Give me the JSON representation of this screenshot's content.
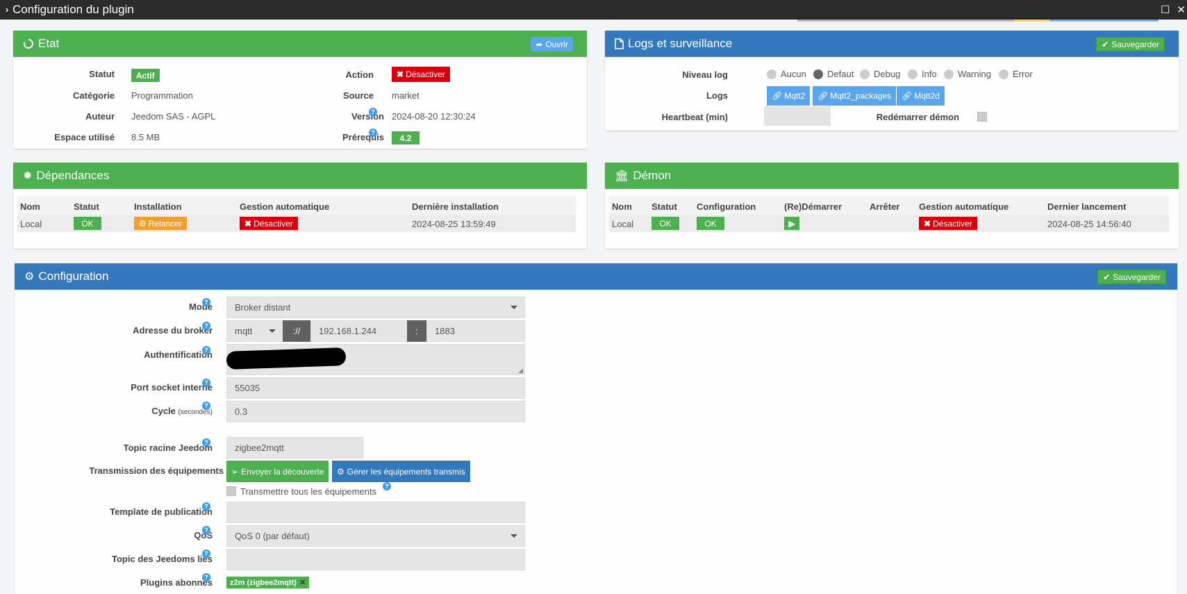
{
  "window": {
    "title": "Configuration du plugin"
  },
  "etat": {
    "title": "Etat",
    "open_btn": "Ouvrir",
    "statut_label": "Statut",
    "statut_value": "Actif",
    "categorie_label": "Catégorie",
    "categorie_value": "Programmation",
    "auteur_label": "Auteur",
    "auteur_value": "Jeedom SAS - AGPL",
    "espace_label": "Espace utilisé",
    "espace_value": "8.5 MB",
    "action_label": "Action",
    "action_btn": "Désactiver",
    "source_label": "Source",
    "source_value": "market",
    "version_label": "Version",
    "version_value": "2024-08-20 12:30:24",
    "prerequis_label": "Prérequis",
    "prerequis_value": "4.2"
  },
  "logs": {
    "title": "Logs et surveillance",
    "save_btn": "Sauvegarder",
    "niveau_label": "Niveau log",
    "levels": [
      "Aucun",
      "Defaut",
      "Debug",
      "Info",
      "Warning",
      "Error"
    ],
    "selected_level": "Defaut",
    "logs_label": "Logs",
    "log_buttons": [
      "Mqtt2",
      "Mqtt2_packages",
      "Mqtt2d"
    ],
    "heartbeat_label": "Heartbeat (min)",
    "heartbeat_value": "",
    "restart_label": "Redémarrer démon"
  },
  "deps": {
    "title": "Dépendances",
    "headers": [
      "Nom",
      "Statut",
      "Installation",
      "Gestion automatique",
      "Dernière installation"
    ],
    "row": {
      "nom": "Local",
      "statut": "OK",
      "installation": "Relancer",
      "gestion": "Désactiver",
      "derniere": "2024-08-25 13:59:49"
    }
  },
  "demon": {
    "title": "Démon",
    "headers": [
      "Nom",
      "Statut",
      "Configuration",
      "(Re)Démarrer",
      "Arrêter",
      "Gestion automatique",
      "Dernier lancement"
    ],
    "row": {
      "nom": "Local",
      "statut": "OK",
      "configuration": "OK",
      "gestion": "Désactiver",
      "dernier": "2024-08-25 14:56:40"
    }
  },
  "config": {
    "title": "Configuration",
    "save_btn": "Sauvegarder",
    "mode_label": "Mode",
    "mode_value": "Broker distant",
    "broker_label": "Adresse du broker",
    "broker_proto": "mqtt",
    "broker_sep": "://",
    "broker_host": "192.168.1.244",
    "broker_colon": ":",
    "broker_port": "1883",
    "auth_label": "Authentification",
    "port_label": "Port socket interne",
    "port_value": "55035",
    "cycle_label": "Cycle",
    "cycle_unit": "(secondes)",
    "cycle_value": "0.3",
    "topic_label": "Topic racine Jeedom",
    "topic_value": "zigbee2mqtt",
    "trans_label": "Transmission des équipements",
    "discover_btn": "Envoyer la découverte",
    "manage_btn": "Gérer les équipements transmis",
    "transmit_all": "Transmettre tous les équipements",
    "template_label": "Template de publication",
    "template_value": "",
    "qos_label": "QoS",
    "qos_value": "QoS 0 (par défaut)",
    "linked_label": "Topic des Jeedoms liés",
    "linked_value": "",
    "plugins_label": "Plugins abonnés",
    "plugins_tag": "z2m (zigbee2mqtt)"
  }
}
